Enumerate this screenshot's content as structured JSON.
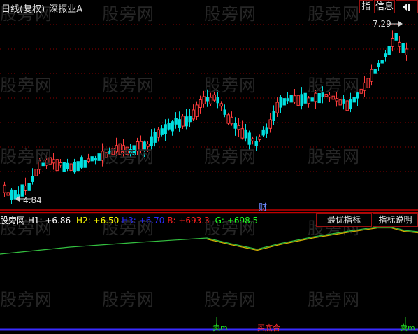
{
  "header": {
    "title": "日线(复权)",
    "stock_name": "深振业A",
    "btn_indicator": "指",
    "btn_info": "信息",
    "arrow_icon": "arrow-left-bar-icon"
  },
  "main_chart": {
    "high_label": "7.29",
    "low_label": "4.84",
    "finance_marker": "财",
    "colors": {
      "up": "#ff3c3c",
      "down": "#00e0e0",
      "grid": "#8b0000",
      "axis": "#b00000"
    }
  },
  "indicator": {
    "name": "股旁网",
    "h1_label": "H1:",
    "h1_value": "+6.86",
    "h2_label": "H2:",
    "h2_value": "+6.50",
    "obscured": "H3: +6.70",
    "b_label": "B:",
    "b_value": "+693.3",
    "g_label": "G:",
    "g_value": "+698.5",
    "btn_best": "最优指标",
    "btn_explain": "指标说明",
    "sell_label_1": "卖m",
    "buy_label": "买底合",
    "sell_label_2": "卖m",
    "colors": {
      "h1": "#ffffff",
      "h2": "#ffff00",
      "h3": "#2b2bff",
      "b": "#ff2020",
      "g": "#20ff20"
    }
  },
  "watermark": "股旁网"
}
